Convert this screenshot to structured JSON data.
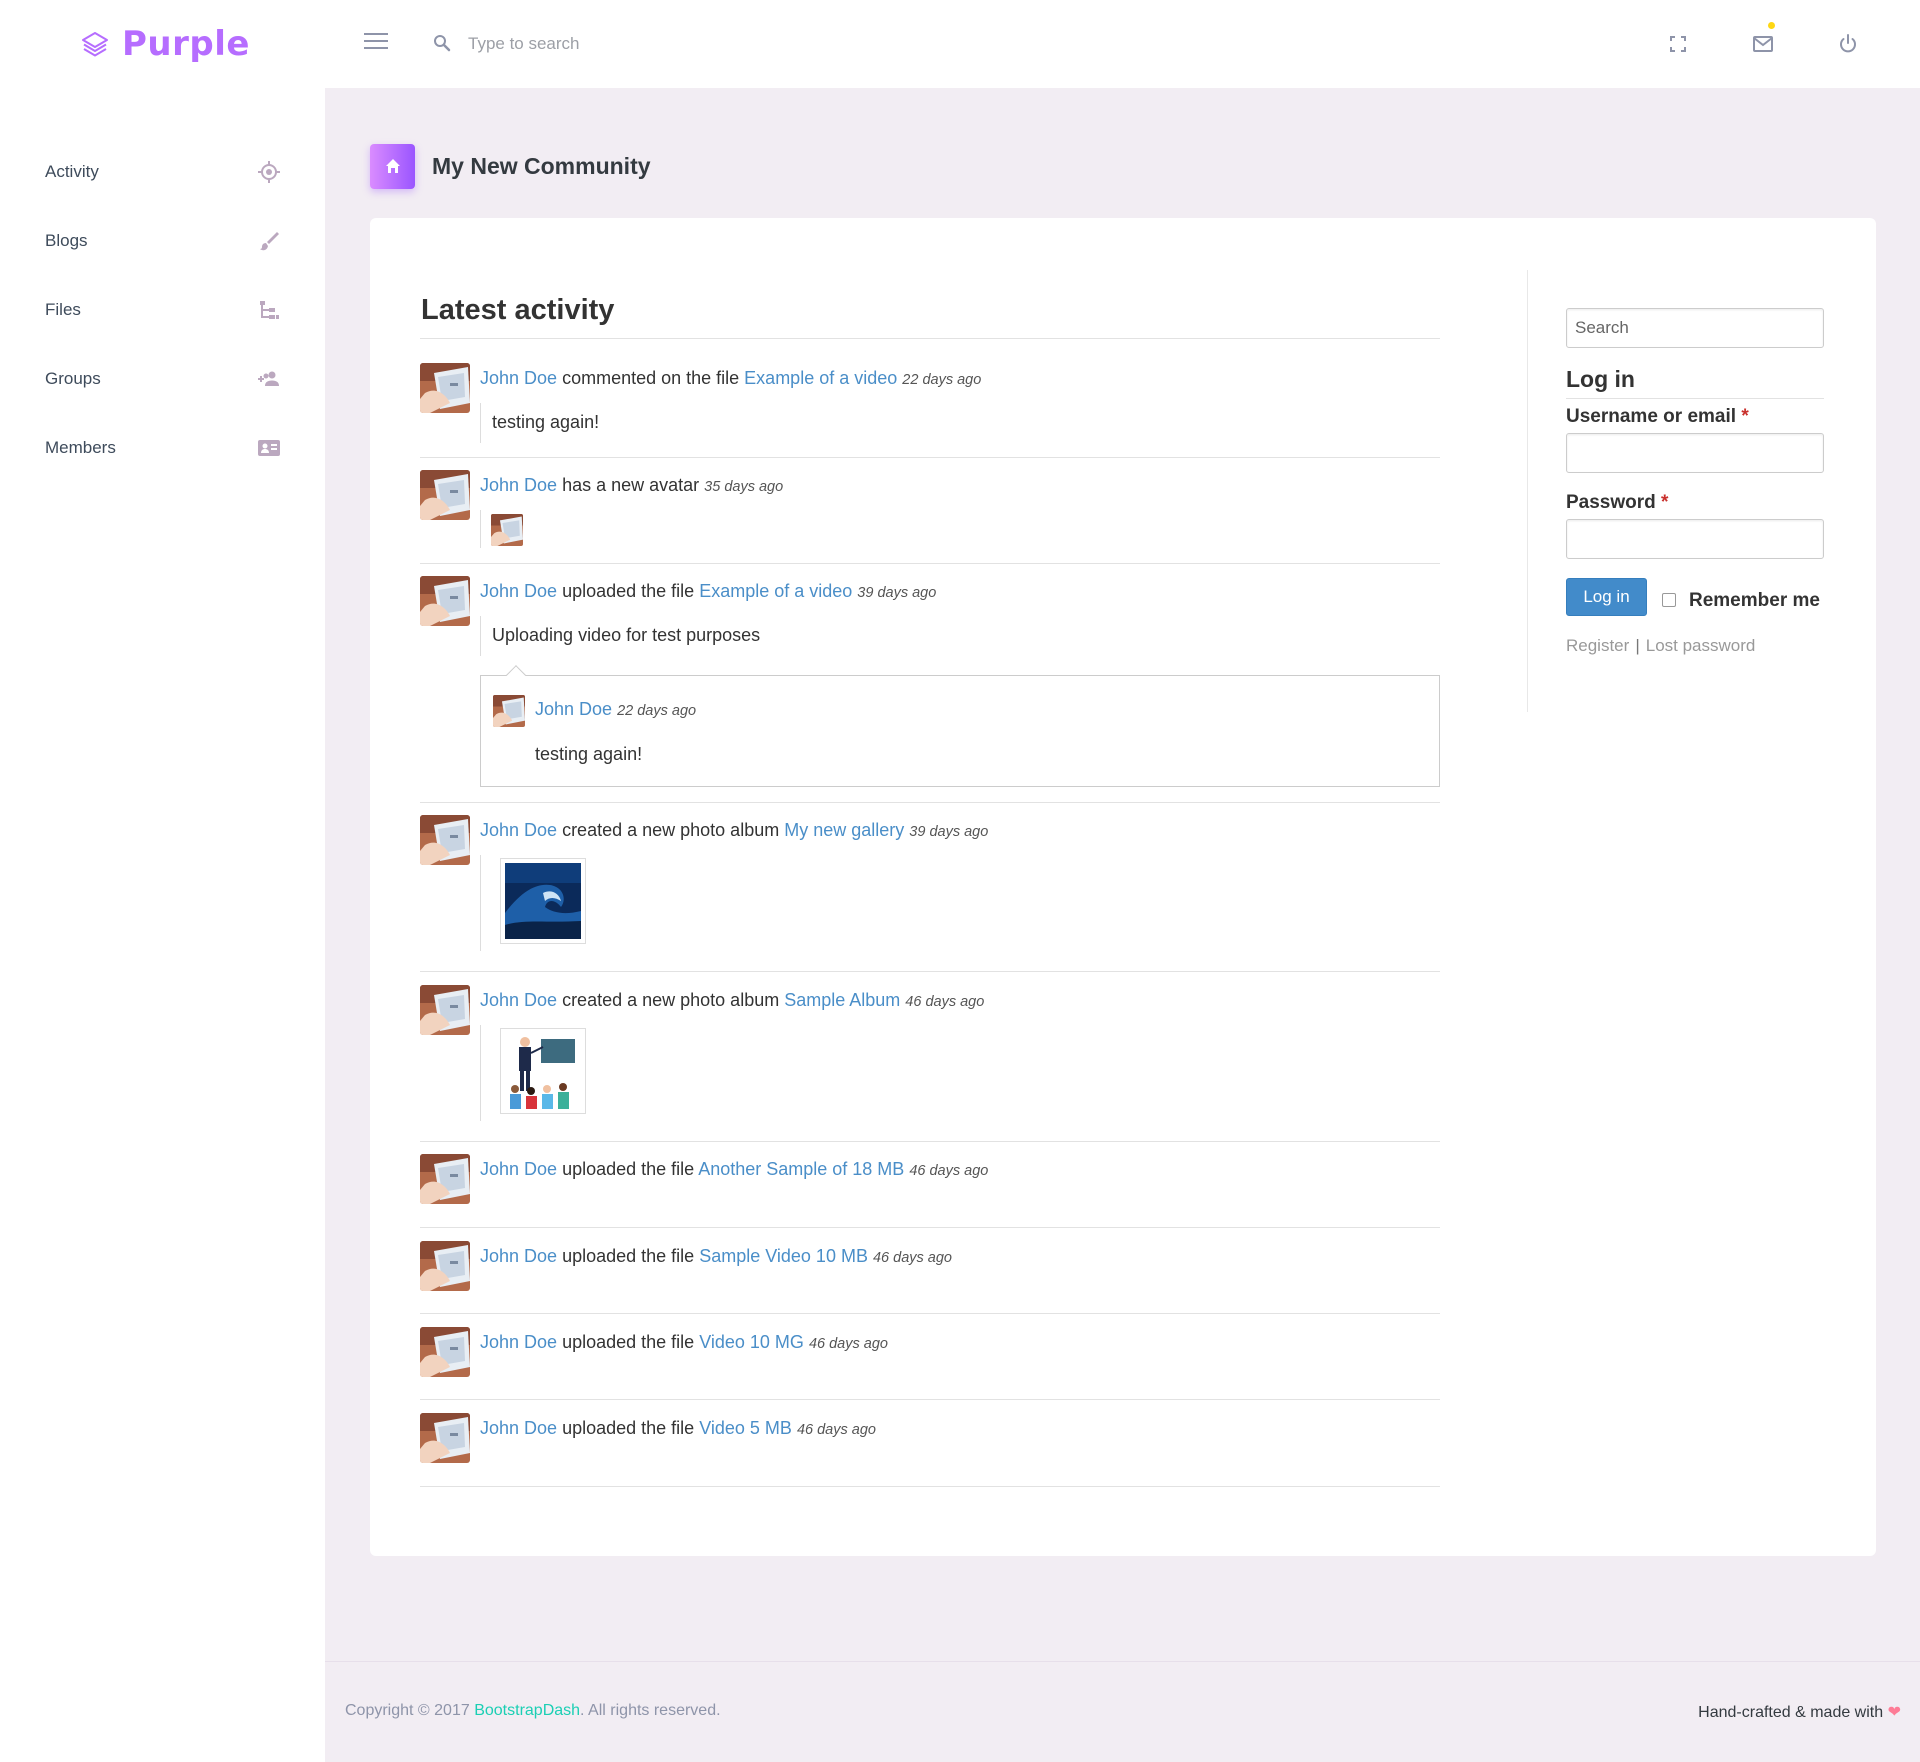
{
  "brand": {
    "name": "Purple",
    "color": "#b66dff"
  },
  "navbar": {
    "search_placeholder": "Type to search",
    "icons": [
      "menu-icon",
      "search-icon",
      "fullscreen-icon",
      "mail-icon",
      "power-icon"
    ]
  },
  "sidebar": {
    "items": [
      {
        "label": "Activity",
        "icon": "target-icon"
      },
      {
        "label": "Blogs",
        "icon": "brush-icon"
      },
      {
        "label": "Files",
        "icon": "file-tree-icon"
      },
      {
        "label": "Groups",
        "icon": "account-plus-icon"
      },
      {
        "label": "Members",
        "icon": "id-card-icon"
      }
    ]
  },
  "page": {
    "title": "My New Community",
    "icon": "home-icon"
  },
  "activity": {
    "heading": "Latest activity",
    "items": [
      {
        "who": "John Doe",
        "action": " commented on the file ",
        "object": "Example of a video",
        "time": "22 days ago",
        "body": "testing again!"
      },
      {
        "who": "John Doe",
        "action": " has a new avatar",
        "object": "",
        "time": "35 days ago"
      },
      {
        "who": "John Doe",
        "action": " uploaded the file ",
        "object": "Example of a video",
        "time": "39 days ago",
        "body": "Uploading video for test purposes",
        "comment": {
          "who": "John Doe",
          "time": "22 days ago",
          "text": "testing again!"
        }
      },
      {
        "who": "John Doe",
        "action": " created a new photo album ",
        "object": "My new gallery",
        "time": "39 days ago",
        "thumb": "wave-photo"
      },
      {
        "who": "John Doe",
        "action": " created a new photo album ",
        "object": "Sample Album",
        "time": "46 days ago",
        "thumb": "presentation-illustration"
      },
      {
        "who": "John Doe",
        "action": " uploaded the file ",
        "object": "Another Sample of 18 MB",
        "time": "46 days ago"
      },
      {
        "who": "John Doe",
        "action": " uploaded the file ",
        "object": "Sample Video 10 MB",
        "time": "46 days ago"
      },
      {
        "who": "John Doe",
        "action": " uploaded the file ",
        "object": "Video 10 MG",
        "time": "46 days ago"
      },
      {
        "who": "John Doe",
        "action": " uploaded the file ",
        "object": "Video 5 MB",
        "time": "46 days ago"
      }
    ]
  },
  "login": {
    "search_placeholder": "Search",
    "title": "Log in",
    "username_label": "Username or email",
    "password_label": "Password",
    "required_mark": "*",
    "button": "Log in",
    "remember": "Remember me",
    "register": "Register",
    "separator": "|",
    "lost_password": "Lost password"
  },
  "footer": {
    "copyright_prefix": "Copyright © 2017 ",
    "brand_link": "BootstrapDash",
    "copyright_suffix": ". All rights reserved.",
    "right_text": "Hand-crafted & made with"
  },
  "colors": {
    "link": "#4a8ec8",
    "accent": "#b66dff",
    "footer_link": "#1bcfb4",
    "heart": "#fe7c96",
    "button": "#428bca"
  }
}
